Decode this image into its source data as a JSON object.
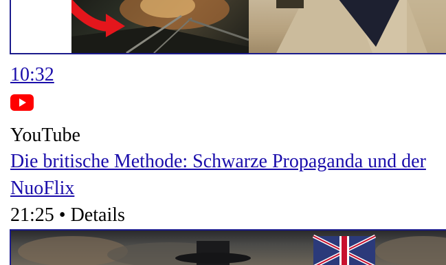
{
  "video": {
    "duration": "10:32",
    "source_icon": "youtube-icon",
    "source": "YouTube",
    "title": "Die britische Methode: Schwarze Propaganda und der",
    "channel": "NuoFlix",
    "meta": "21:25 • Details"
  },
  "colors": {
    "link": "#1a0dab",
    "youtube_red": "#ff0000",
    "thumbnail_border": "#1a1a8c"
  }
}
